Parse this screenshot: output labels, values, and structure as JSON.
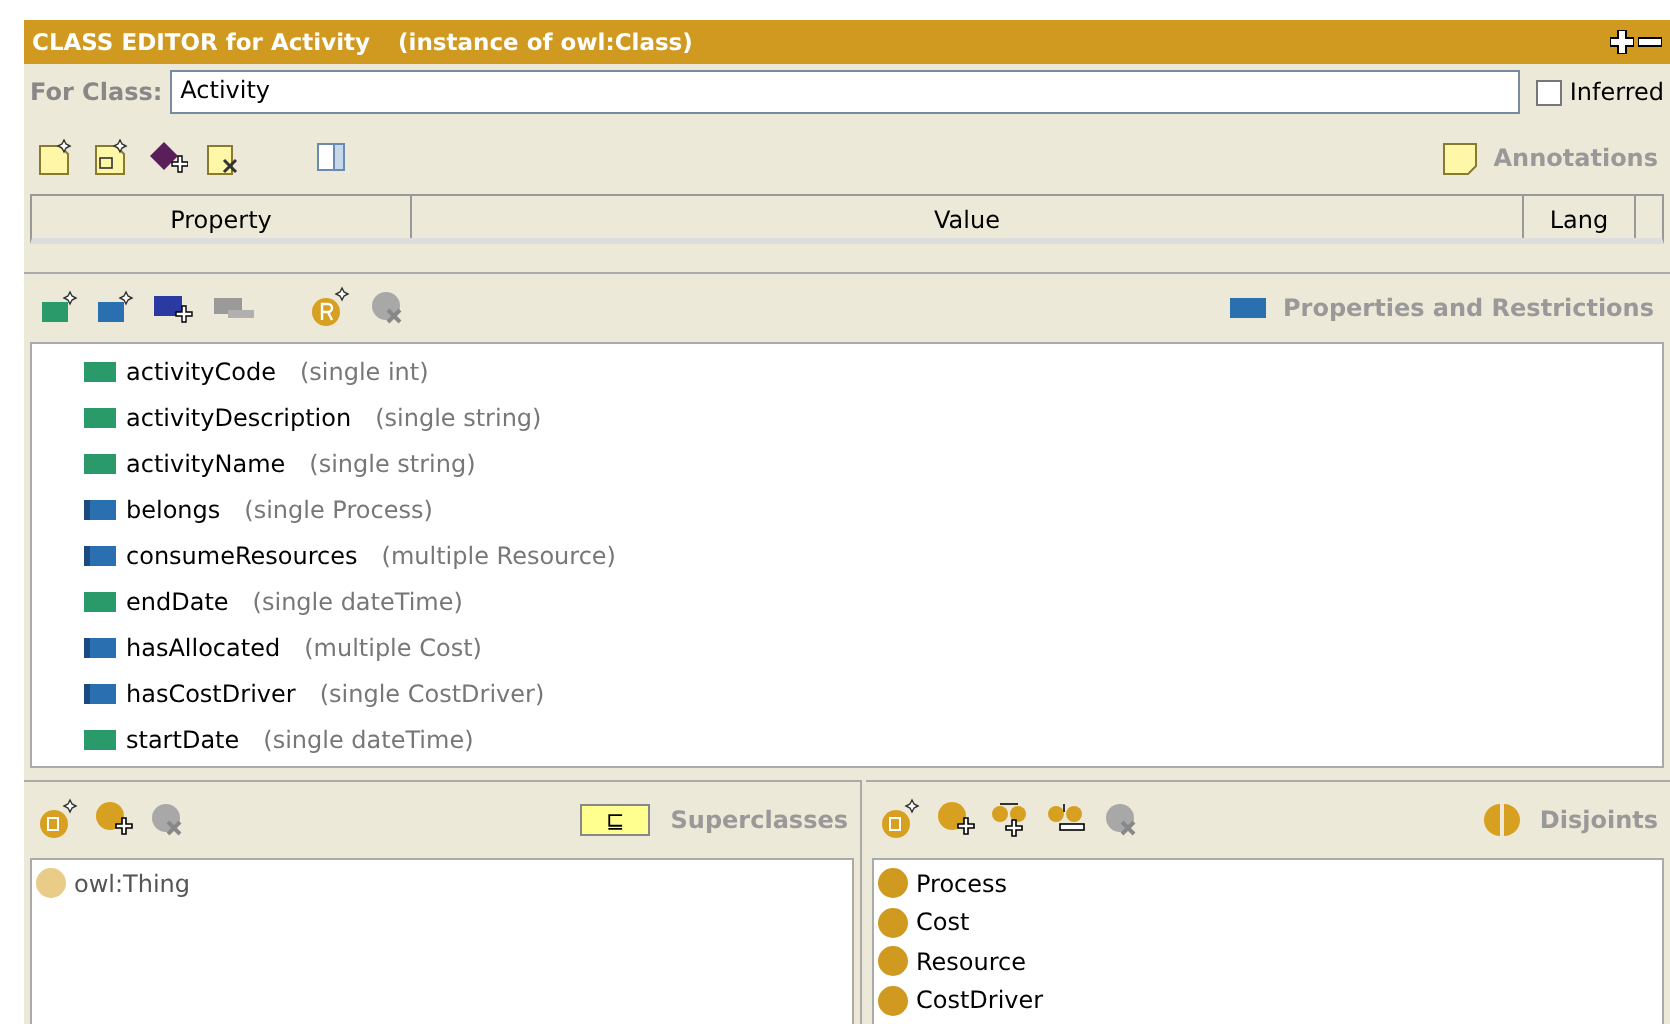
{
  "window": {
    "title": "CLASS EDITOR for Activity",
    "subtitle": "(instance of owl:Class)"
  },
  "for_class": {
    "label": "For Class:",
    "value": "Activity"
  },
  "inferred": {
    "label": "Inferred",
    "checked": false
  },
  "annotations": {
    "label": "Annotations",
    "columns": [
      "Property",
      "Value",
      "Lang"
    ]
  },
  "properties": {
    "label": "Properties and Restrictions",
    "items": [
      {
        "name": "activityCode",
        "detail": "(single int)",
        "kind": "datatype"
      },
      {
        "name": "activityDescription",
        "detail": "(single string)",
        "kind": "datatype"
      },
      {
        "name": "activityName",
        "detail": "(single string)",
        "kind": "datatype"
      },
      {
        "name": "belongs",
        "detail": "(single Process)",
        "kind": "object"
      },
      {
        "name": "consumeResources",
        "detail": "(multiple Resource)",
        "kind": "object"
      },
      {
        "name": "endDate",
        "detail": "(single dateTime)",
        "kind": "datatype"
      },
      {
        "name": "hasAllocated",
        "detail": "(multiple Cost)",
        "kind": "object"
      },
      {
        "name": "hasCostDriver",
        "detail": "(single CostDriver)",
        "kind": "object"
      },
      {
        "name": "startDate",
        "detail": "(single dateTime)",
        "kind": "datatype"
      }
    ]
  },
  "superclasses": {
    "label": "Superclasses",
    "symbol": "⊑",
    "items": [
      "owl:Thing"
    ]
  },
  "disjoints": {
    "label": "Disjoints",
    "items": [
      "Process",
      "Cost",
      "Resource",
      "CostDriver"
    ]
  }
}
